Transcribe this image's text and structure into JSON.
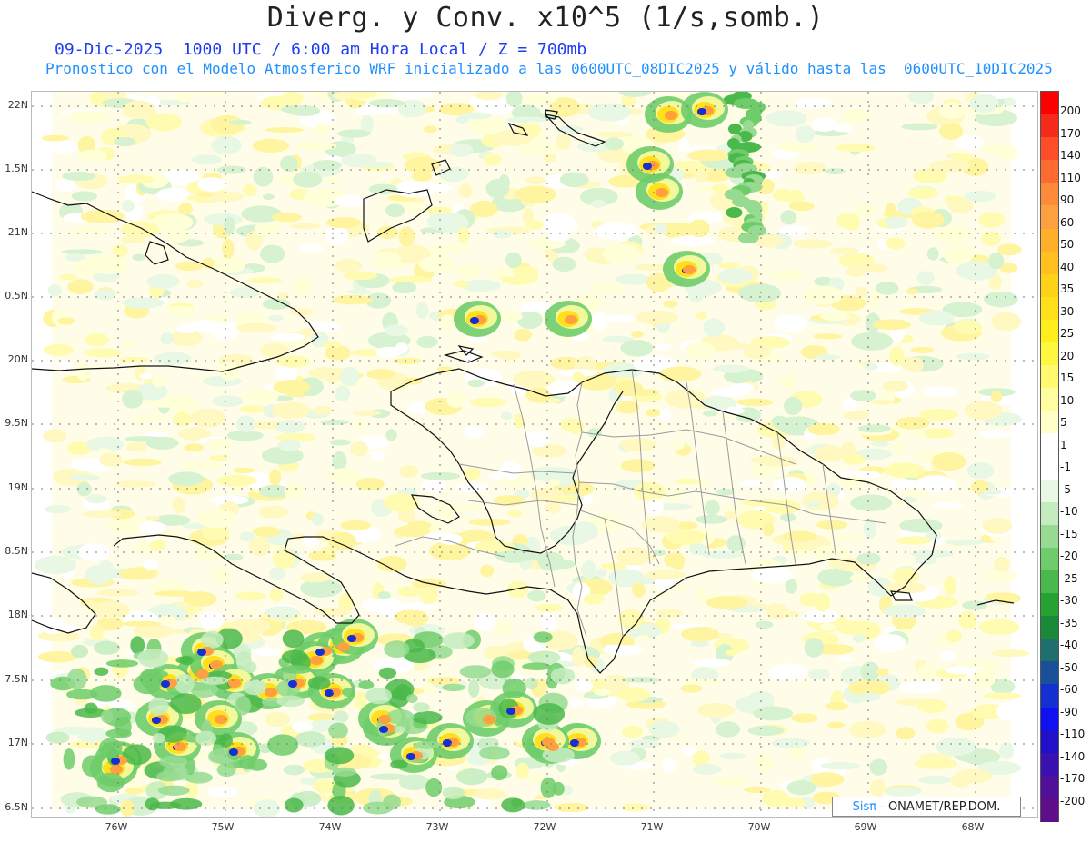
{
  "header": {
    "title": "Diverg. y Conv. x10^5 (1/s,somb.)",
    "subtitle": "09-Dic-2025  1000 UTC / 6:00 am Hora Local / Z = 700mb",
    "subtitle2": "Pronostico con el Modelo Atmosferico WRF inicializado a las 0600UTC_08DIC2025 y válido hasta las  0600UTC_10DIC2025"
  },
  "axes": {
    "lat_labels": [
      "22N",
      "1.5N",
      "21N",
      "0.5N",
      "20N",
      "9.5N",
      "19N",
      "8.5N",
      "18N",
      "7.5N",
      "17N",
      "6.5N"
    ],
    "lon_labels": [
      "76W",
      "75W",
      "74W",
      "73W",
      "72W",
      "71W",
      "70W",
      "69W",
      "68W"
    ],
    "lat_range": [
      16.5,
      22
    ],
    "lon_range": [
      -76.6,
      -67.6
    ]
  },
  "colorbar": {
    "labels": [
      "200",
      "170",
      "140",
      "110",
      "90",
      "60",
      "50",
      "40",
      "35",
      "30",
      "25",
      "20",
      "15",
      "10",
      "5",
      "1",
      "-1",
      "-5",
      "-10",
      "-15",
      "-20",
      "-25",
      "-30",
      "-35",
      "-40",
      "-50",
      "-60",
      "-90",
      "-110",
      "-140",
      "-170",
      "-200"
    ],
    "colors": [
      "#ff0000",
      "#f52a1a",
      "#ff4d2a",
      "#ff6a30",
      "#ff8a3a",
      "#ffa040",
      "#ffb028",
      "#ffc020",
      "#ffd21a",
      "#ffe01a",
      "#ffee1c",
      "#fff640",
      "#fffa70",
      "#fffda0",
      "#ffffc8",
      "#ffffff",
      "#ffffff",
      "#e8f8e4",
      "#c4ecbf",
      "#96db91",
      "#6fcc6a",
      "#4ab84a",
      "#24a330",
      "#1a8a3a",
      "#1f6f6f",
      "#1a4f9a",
      "#1530d0",
      "#1010f0",
      "#2010c8",
      "#3a10b0",
      "#50109a",
      "#600d8a"
    ]
  },
  "credit": {
    "brand": "Sisπ",
    "text": "- ONAMET/REP.DOM."
  },
  "map_legend": {
    "fill": "divergence/convergence shading",
    "colors": {
      "land_border": "#111111",
      "province_border": "#9a9a9a",
      "grid": "#777777"
    }
  }
}
